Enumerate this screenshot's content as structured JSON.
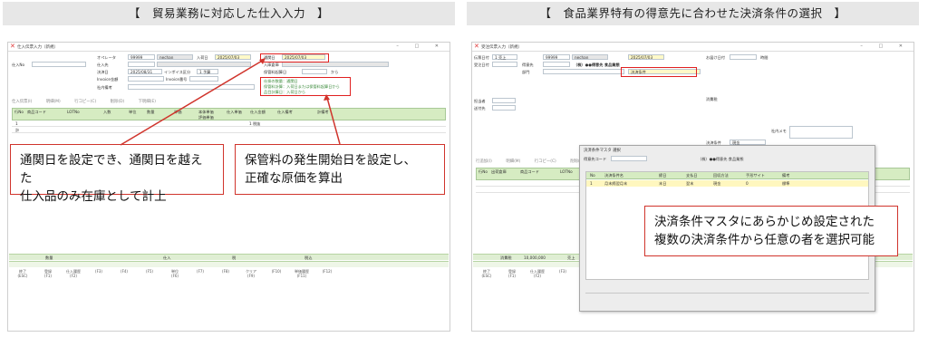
{
  "left": {
    "heading": "【　貿易業務に対応した仕入入力　】",
    "window_title": "仕入伝票入力（新規）",
    "fields": {
      "operator_label": "オペレータ",
      "operator_code": "99999",
      "operator_name": "nechan",
      "entry_date_label": "入荷日",
      "entry_date": "2025/07/03",
      "supplier_label": "仕入先",
      "decision_label": "決済日",
      "decision_date": "2025/08/31",
      "invoice_label": "Invoice金額",
      "invoice_label2": "Invoice番号",
      "remarks_label": "社内備考",
      "warehouse_label": "仕入No",
      "incoterms": "インボイス区分",
      "incoterm_value": "1 予算",
      "clearance_label": "通関日",
      "clearance_date": "2025/07/03",
      "customs_label": "入庫倉庫",
      "storage_start_label": "保管料起算日",
      "range_label": "から",
      "note1": "仕掛の数量：通関日",
      "note2": "保管料計算：入荷日または保管料起算日から",
      "note3": "品目計算日：入荷日から"
    },
    "tabs": [
      "仕入伝票(I)",
      "明細(M)",
      "行コピー(C)",
      "削除(D)",
      "下明細(E)"
    ],
    "grid_headers": [
      "行No",
      "商品コード",
      "LOTNo",
      "入数",
      "単位",
      "数量",
      "単価",
      "本体単価",
      "仕入単価",
      "仕入金額",
      "仕入備考",
      "計備考"
    ],
    "grid_row": {
      "no": "1",
      "sub": "計",
      "price": "評価単価",
      "method": "1 税抜"
    },
    "status": {
      "qty_label": "数量",
      "supply_label": "仕入",
      "tax_label": "税",
      "total_label": "税込"
    },
    "fkeys": [
      {
        "top": "終了",
        "bottom": "(ESC)"
      },
      {
        "top": "登録",
        "bottom": "(F1)"
      },
      {
        "top": "仕入履歴",
        "bottom": "(F2)"
      },
      {
        "top": "",
        "bottom": "(F3)"
      },
      {
        "top": "",
        "bottom": "(F4)"
      },
      {
        "top": "",
        "bottom": "(F5)"
      },
      {
        "top": "単位",
        "bottom": "(F6)"
      },
      {
        "top": "",
        "bottom": "(F7)"
      },
      {
        "top": "",
        "bottom": "(F8)"
      },
      {
        "top": "クリア",
        "bottom": "(F9)"
      },
      {
        "top": "",
        "bottom": "(F10)"
      },
      {
        "top": "単価履歴",
        "bottom": "(F11)"
      },
      {
        "top": "",
        "bottom": "(F12)"
      }
    ],
    "callout_a": [
      "通関日を設定でき、通関日を越えた",
      "仕入品のみ在庫として計上"
    ],
    "callout_b": [
      "保管料の発生開始日を設定し、",
      "正確な原価を算出"
    ]
  },
  "right": {
    "heading": "【　食品業界特有の得意先に合わせた決済条件の選択　】",
    "window_title": "受注伝票入力（新規）",
    "fields": {
      "date_label": "伝票日付",
      "date_prefix": "1 売上",
      "operator_code": "99999",
      "operator_name": "nechan",
      "receive_label": "受注日付",
      "receive_date": "2025/07/03",
      "customer_label": "得意先",
      "customer_name": "（株）●●得意先 食品業態",
      "payment_label": "決済条件",
      "deliver_label": "お届け日付",
      "deliver_value": "時間",
      "staff_label": "担当者",
      "dept_label": "部門",
      "send_label": "送付先",
      "tax_label": "消費税",
      "condition_label": "決済条件",
      "condition_value": "現金",
      "memo_label": "社内メモ"
    },
    "tabs": [
      "行追加(I)",
      "明細(M)",
      "行コピー(C)",
      "削除(D)",
      "下明細(E)"
    ],
    "grid_headers": [
      "行No",
      "出荷倉庫",
      "商品コード",
      "LOTNo",
      "入数",
      "単位",
      "数量",
      "本体単価",
      "売上本体金額",
      "原単・金利",
      "粗利",
      "仕入単価"
    ],
    "dialog": {
      "title": "決済条件マスタ 選択",
      "search_label": "得意先コード",
      "customer": "（株）●●得意先 食品業態",
      "headers": [
        "No",
        "決済条件名",
        "締日",
        "支払日",
        "回収方法",
        "手形サイト",
        "備考"
      ],
      "rows": [
        [
          "1",
          "月末締翌月末",
          "末日",
          "翌末",
          "現金",
          "0",
          "標準"
        ]
      ]
    },
    "status": {
      "amount": "10,000,000",
      "tax_label": "消費税",
      "sales_label": "売上"
    },
    "callout": [
      "決済条件マスタにあらかじめ設定された",
      "複数の決済条件から任意の者を選択可能"
    ]
  }
}
